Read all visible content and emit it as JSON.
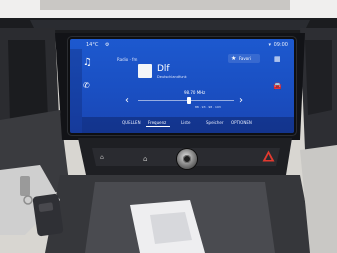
{
  "status": {
    "temperature": "14°C",
    "clock": "09:00",
    "signal": "ዎ"
  },
  "nav": {
    "music_icon": "music-note-icon",
    "phone_icon": "phone-icon"
  },
  "now_playing": {
    "source": "Radio · fm",
    "station": "Dlf",
    "subtitle": "Deutschlandfunk",
    "frequency": "98.70 MHz",
    "ticks": "88 · 93 · 98 · 103"
  },
  "actions": {
    "favorites_label": "Favori",
    "apps_icon": "apps-grid-icon",
    "car_icon": "car-icon"
  },
  "tabs": [
    {
      "label": "QUELLEN"
    },
    {
      "label": "Frequenz"
    },
    {
      "label": "Liste"
    },
    {
      "label": "Speicher"
    },
    {
      "label": "OPTIONEN"
    }
  ],
  "colors": {
    "screen_blue": "#1d59cf",
    "hazard_red": "#e23a2f"
  }
}
